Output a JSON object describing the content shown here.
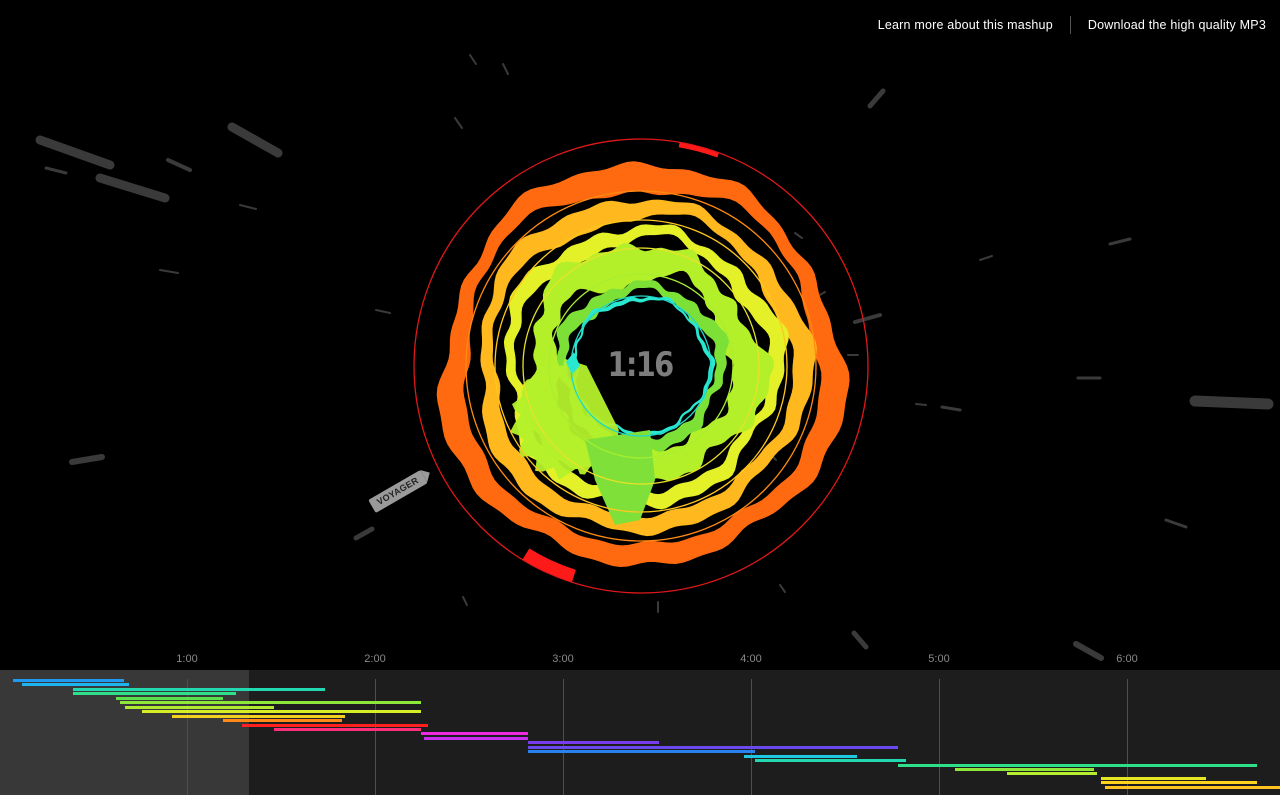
{
  "nav": {
    "learn_more": "Learn more about this mashup",
    "download": "Download the high quality MP3"
  },
  "player": {
    "current_time": "1:16",
    "progress_fraction": 0.187,
    "total_minutes": 6.65,
    "marker_label": "VOYAGER"
  },
  "timeline": {
    "ticks": [
      "1:00",
      "2:00",
      "3:00",
      "4:00",
      "5:00",
      "6:00"
    ],
    "tracks": [
      {
        "start": 0.03,
        "end": 0.62,
        "color": "#1e9bf0"
      },
      {
        "start": 0.08,
        "end": 0.65,
        "color": "#1eb4f0"
      },
      {
        "start": 0.35,
        "end": 1.69,
        "color": "#21d8b0"
      },
      {
        "start": 0.35,
        "end": 1.22,
        "color": "#2ee08a"
      },
      {
        "start": 0.58,
        "end": 1.15,
        "color": "#5ae04a"
      },
      {
        "start": 0.6,
        "end": 2.2,
        "color": "#8ee83a"
      },
      {
        "start": 0.63,
        "end": 1.42,
        "color": "#b0ea30"
      },
      {
        "start": 0.72,
        "end": 2.2,
        "color": "#d6ee26"
      },
      {
        "start": 0.88,
        "end": 1.8,
        "color": "#f2d020"
      },
      {
        "start": 1.15,
        "end": 1.78,
        "color": "#ff8a18"
      },
      {
        "start": 1.25,
        "end": 2.24,
        "color": "#ff2020"
      },
      {
        "start": 1.42,
        "end": 2.2,
        "color": "#ff2e7a"
      },
      {
        "start": 2.2,
        "end": 2.77,
        "color": "#ee2ae0"
      },
      {
        "start": 2.22,
        "end": 2.77,
        "color": "#c830ee"
      },
      {
        "start": 2.77,
        "end": 3.47,
        "color": "#7a3aee"
      },
      {
        "start": 2.77,
        "end": 4.74,
        "color": "#6a4aee"
      },
      {
        "start": 2.77,
        "end": 3.98,
        "color": "#2a82f0"
      },
      {
        "start": 3.92,
        "end": 4.52,
        "color": "#1ec8e0"
      },
      {
        "start": 3.98,
        "end": 4.78,
        "color": "#21d8b0"
      },
      {
        "start": 4.74,
        "end": 6.65,
        "color": "#2ee08a"
      },
      {
        "start": 5.04,
        "end": 5.78,
        "color": "#8ee83a"
      },
      {
        "start": 5.32,
        "end": 5.8,
        "color": "#b8ec2e"
      },
      {
        "start": 5.82,
        "end": 6.38,
        "color": "#e6e624"
      },
      {
        "start": 5.82,
        "end": 6.65,
        "color": "#ffd21e"
      },
      {
        "start": 5.84,
        "end": 6.77,
        "color": "#ffc21e"
      }
    ]
  },
  "rings": [
    {
      "base": 190,
      "amp": 9,
      "width": 30,
      "color": "#ff6a10",
      "phase": 0.3
    },
    {
      "base": 158,
      "amp": 8,
      "width": 24,
      "color": "#ffb81e",
      "phase": 1.5
    },
    {
      "base": 132,
      "amp": 10,
      "width": 20,
      "color": "#e4f028",
      "phase": 2.2
    },
    {
      "base": 104,
      "amp": 12,
      "width": 42,
      "color": "#b4f02a",
      "phase": 0.9
    },
    {
      "base": 78,
      "amp": 7,
      "width": 16,
      "color": "#7ce036",
      "phase": 2.8
    },
    {
      "base": 68,
      "amp": 5,
      "width": 5,
      "color": "#2ae8d0",
      "phase": 1.1
    }
  ],
  "guide_rings": [
    {
      "r": 227,
      "color": "#e01818"
    },
    {
      "r": 175,
      "color": "#ff8a10"
    },
    {
      "r": 146,
      "color": "#ffc81e"
    },
    {
      "r": 118,
      "color": "#e8e228"
    },
    {
      "r": 92,
      "color": "#a8ee30"
    },
    {
      "r": 70,
      "color": "#20d8c8"
    }
  ]
}
